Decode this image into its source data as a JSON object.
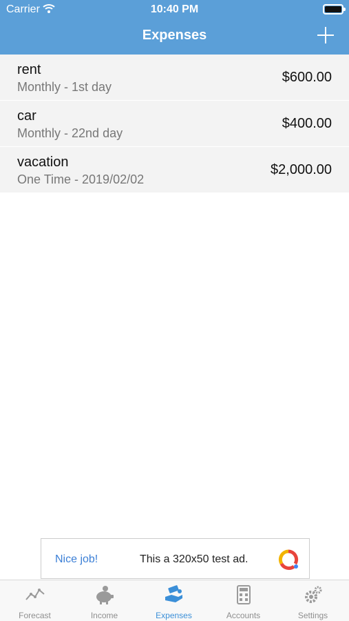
{
  "status_bar": {
    "carrier": "Carrier",
    "time": "10:40 PM"
  },
  "header": {
    "title": "Expenses",
    "add_icon": "plus-icon"
  },
  "expenses": [
    {
      "name": "rent",
      "schedule": "Monthly - 1st day",
      "amount": "$600.00"
    },
    {
      "name": "car",
      "schedule": "Monthly - 22nd day",
      "amount": "$400.00"
    },
    {
      "name": "vacation",
      "schedule": "One Time - 2019/02/02",
      "amount": "$2,000.00"
    }
  ],
  "ad": {
    "headline": "Nice job!",
    "text": "This a 320x50 test ad."
  },
  "tabs": [
    {
      "label": "Forecast",
      "icon": "line-chart-icon",
      "active": false
    },
    {
      "label": "Income",
      "icon": "piggy-bank-icon",
      "active": false
    },
    {
      "label": "Expenses",
      "icon": "hand-money-icon",
      "active": true
    },
    {
      "label": "Accounts",
      "icon": "calculator-icon",
      "active": false
    },
    {
      "label": "Settings",
      "icon": "gear-icon",
      "active": false
    }
  ],
  "colors": {
    "header": "#5b9fd8",
    "active_tab": "#3b8fd8",
    "inactive_tab": "#8e8e8e"
  }
}
